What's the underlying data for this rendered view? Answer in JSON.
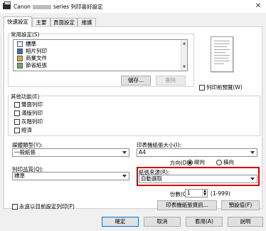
{
  "window": {
    "title_prefix": "Canon",
    "title_suffix": "series 列印喜好設定",
    "close_label": "✕"
  },
  "tabs": [
    {
      "label": "快速設定"
    },
    {
      "label": "主要"
    },
    {
      "label": "頁面設定"
    },
    {
      "label": "維護"
    }
  ],
  "presets": {
    "group_label": "常用設定(S)",
    "items": [
      {
        "label": "標準",
        "selected": true
      },
      {
        "label": "相片列印",
        "selected": false
      },
      {
        "label": "商業文件",
        "selected": false
      },
      {
        "label": "節省紙張",
        "selected": false
      }
    ],
    "save_label": "儲存...",
    "delete_label": "刪除"
  },
  "preview": {
    "checkbox_label": "列印前預覽(W)"
  },
  "other_features": {
    "group_label": "其他功能(E)",
    "items": [
      {
        "label": "雙面列印"
      },
      {
        "label": "滿版列印"
      },
      {
        "label": "灰階列印"
      },
      {
        "label": "經濟"
      }
    ]
  },
  "media_type": {
    "label": "媒體類型(Y):",
    "value": "一般紙張"
  },
  "paper_size": {
    "label": "印表機紙張大小(I):",
    "value": "A4"
  },
  "orientation": {
    "label": "方向(D):",
    "portrait_label": "縱向",
    "landscape_label": "橫向",
    "selected": "portrait"
  },
  "print_quality": {
    "label": "列印品質(Q):",
    "value": "標準"
  },
  "paper_source": {
    "label": "紙張來源(R):",
    "value": "自動選取"
  },
  "copies": {
    "label": "份數(C):",
    "value": "1",
    "range": "(1-999)"
  },
  "always_print": {
    "label": "永遠以目前設定列印(P)"
  },
  "printer_paper_info_button": "印表機紙張資訊...",
  "defaults_button": "預設值(F)",
  "footer": {
    "ok": "確定",
    "cancel": "取消",
    "apply": "套用(A)",
    "help": "說明"
  }
}
